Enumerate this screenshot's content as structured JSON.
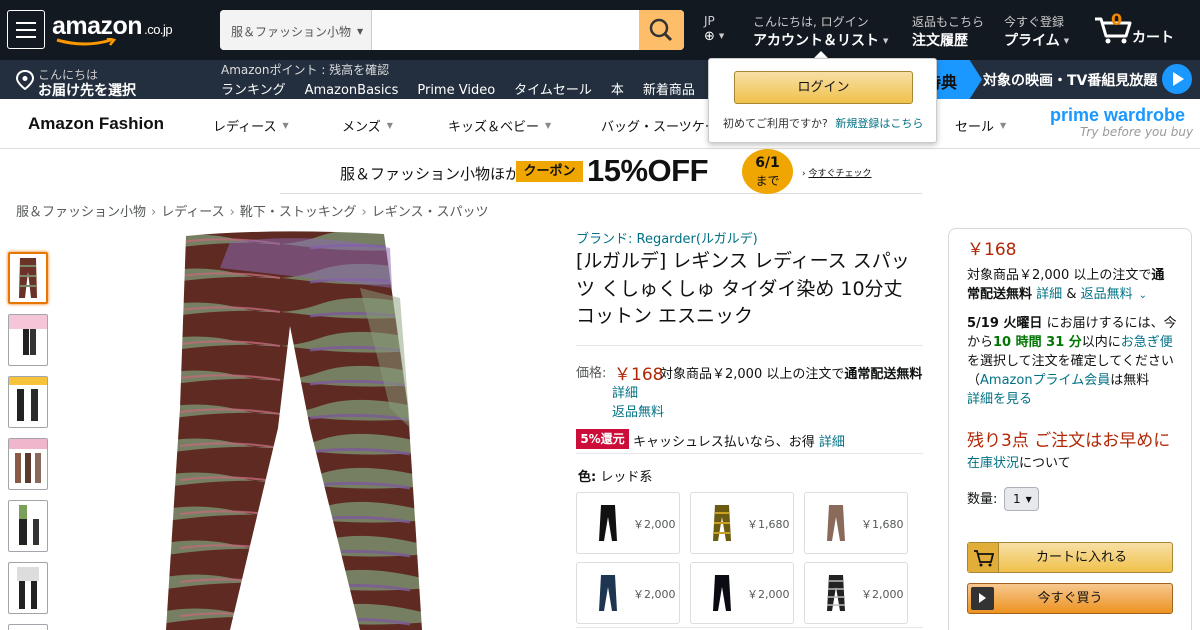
{
  "nav": {
    "logo_text": "amazon",
    "logo_tld": ".co.jp",
    "search_category": "服＆ファッション小物",
    "search_placeholder": "",
    "lang": "JP",
    "greeting": "こんにちは, ログイン",
    "account_label": "アカウント＆リスト",
    "returns_small": "返品もこちら",
    "orders_label": "注文履歴",
    "prime_small": "今すぐ登録",
    "prime_label": "プライム",
    "cart_count": "0",
    "cart_label": "カート"
  },
  "subnav": {
    "deliver_small": "こんにちは",
    "deliver_label": "お届け先を選択",
    "points": "Amazonポイント : 残高を確認",
    "links": [
      "ランキング",
      "AmazonBasics",
      "Prime Video",
      "タイムセール",
      "本",
      "新着商品",
      "ベ"
    ],
    "promo_tag": "特典",
    "promo_text": "対象の映画・TV番組見放題"
  },
  "flyout": {
    "login_button": "ログイン",
    "first_time": "初めてご利用ですか?",
    "register_link": "新規登録はこちら"
  },
  "fashion": {
    "brand": "Amazon Fashion",
    "items": [
      "レディース",
      "メンズ",
      "キッズ＆ベビー",
      "バッグ・スーツケース",
      "セール"
    ],
    "wardrobe_title": "prime wardrobe",
    "wardrobe_sub": "Try before you buy"
  },
  "banner": {
    "text": "服＆ファッション小物ほか",
    "coupon": "クーポン",
    "discount": "15%OFF",
    "until_date": "6/1",
    "until_label": "まで",
    "check_link": "今すぐチェック"
  },
  "breadcrumb": [
    "服＆ファッション小物",
    "レディース",
    "靴下・ストッキング",
    "レギンス・スパッツ"
  ],
  "product": {
    "brand": "ブランド: Regarder(ルガルデ)",
    "title": "[ルガルデ] レギンス レディース スパッツ くしゅくしゅ タイダイ染め 10分丈 コットン エスニック",
    "price_label": "価格:",
    "price": "￥168",
    "shipping_note_prefix": "対象商品￥2,000 以上の注文で",
    "shipping_note_bold": "通常配送無料",
    "details_link": "詳細",
    "returns_link": "返品無料",
    "cashless_badge": "5%還元",
    "cashless_text": "キャッシュレス払いなら、お得",
    "cashless_link": "詳細",
    "color_label": "色:",
    "color_value": "レッド系",
    "swatches": [
      {
        "price": "￥2,000",
        "color": "#111111"
      },
      {
        "price": "￥1,680",
        "color": "#6b5a12"
      },
      {
        "price": "￥1,680",
        "color": "#8a6a5a"
      },
      {
        "price": "￥2,000",
        "color": "#1d3550"
      },
      {
        "price": "￥2,000",
        "color": "#0b0b14"
      },
      {
        "price": "￥2,000",
        "color": "#222222"
      }
    ]
  },
  "buybox": {
    "price": "￥168",
    "ship_prefix": "対象商品￥2,000 以上の注文で",
    "ship_bold": "通常配送無料",
    "details_link": "詳細",
    "and": "&",
    "returns_link": "返品無料",
    "delivery_date": "5/19 火曜日",
    "delivery_text1": "にお届けするには、今から",
    "delivery_time": "10 時間 31 分",
    "delivery_text2": "以内に",
    "express_link": "お急ぎ便",
    "delivery_text3": "を選択して注文を確定してください（",
    "prime_link": "Amazonプライム会員",
    "delivery_text4": "は無料",
    "see_details": "詳細を見る",
    "stock_warning": "残り3点 ご注文はお早めに",
    "stock_link": "在庫状況",
    "stock_suffix": "について",
    "qty_label": "数量:",
    "qty_value": "1",
    "add_to_cart": "カートに入れる",
    "buy_now": "今すぐ買う"
  },
  "colors": {
    "nav_bg": "#131921",
    "subnav_bg": "#232f3e",
    "accent": "#febd69",
    "price": "#b12704",
    "link": "#007185"
  }
}
